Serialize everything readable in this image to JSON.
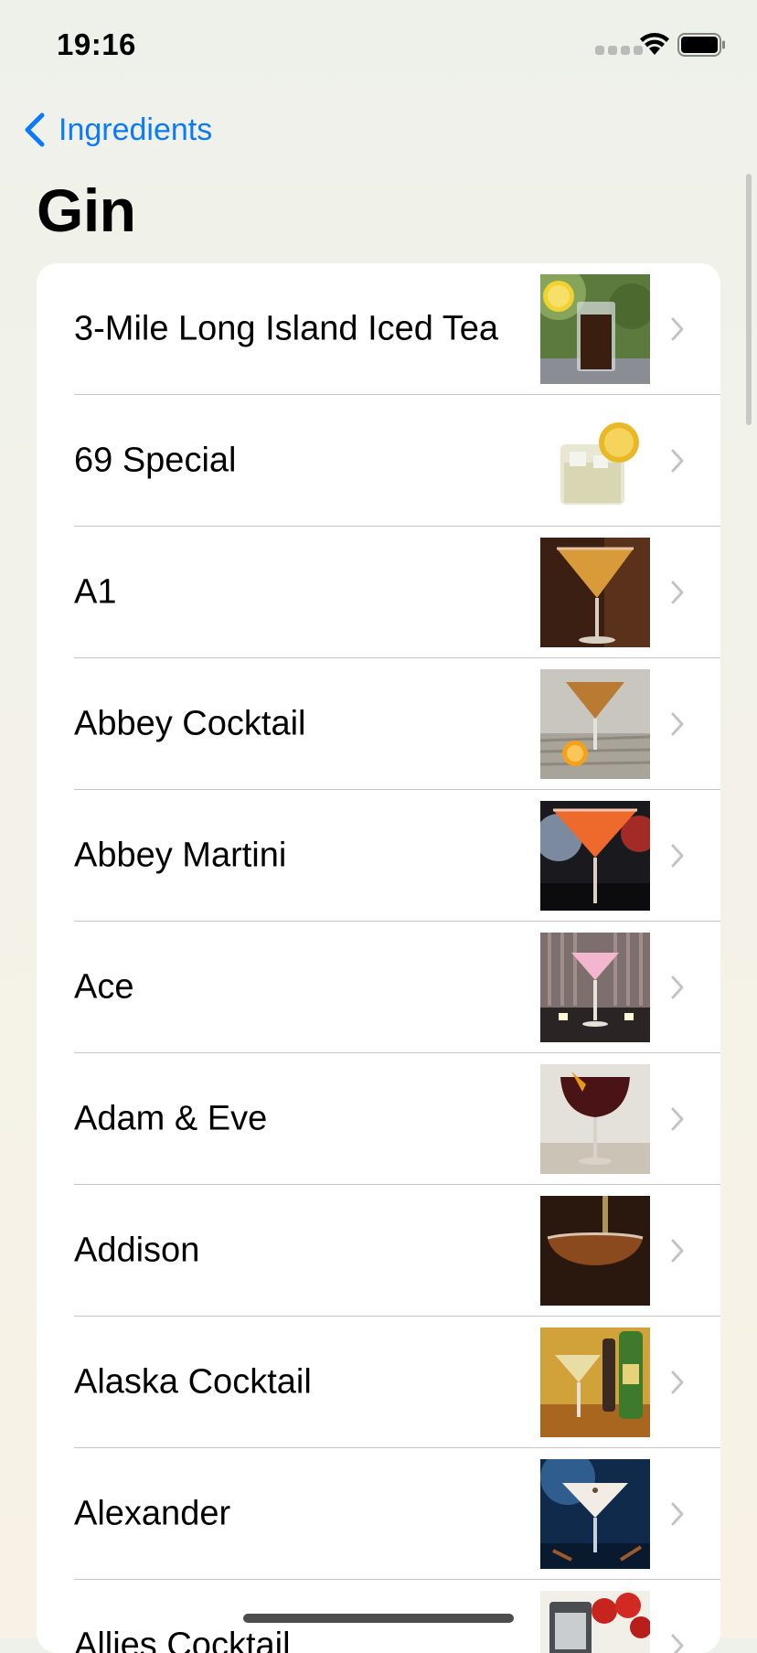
{
  "status": {
    "time": "19:16"
  },
  "nav": {
    "back_label": "Ingredients"
  },
  "page": {
    "title": "Gin"
  },
  "colors": {
    "accent": "#0a7aff",
    "separator": "#c6c6c8",
    "chevron": "#c4c4c7"
  },
  "drinks": [
    {
      "name": "3-Mile Long Island Iced Tea",
      "image": "cola-highball-with-lemon"
    },
    {
      "name": "69 Special",
      "image": "lemon-rocks-glass"
    },
    {
      "name": "A1",
      "image": "orange-martini-glass"
    },
    {
      "name": "Abbey Cocktail",
      "image": "cocktail-glass-with-orange"
    },
    {
      "name": "Abbey Martini",
      "image": "red-orange-cocktail"
    },
    {
      "name": "Ace",
      "image": "pink-cocktail-with-candles"
    },
    {
      "name": "Adam & Eve",
      "image": "dark-red-cocktail-with-twist"
    },
    {
      "name": "Addison",
      "image": "amber-drink-pouring"
    },
    {
      "name": "Alaska Cocktail",
      "image": "yellow-cocktail-with-bottles"
    },
    {
      "name": "Alexander",
      "image": "creamy-cocktail-blue"
    },
    {
      "name": "Allies Cocktail",
      "image": "glass-with-tomatoes"
    }
  ]
}
